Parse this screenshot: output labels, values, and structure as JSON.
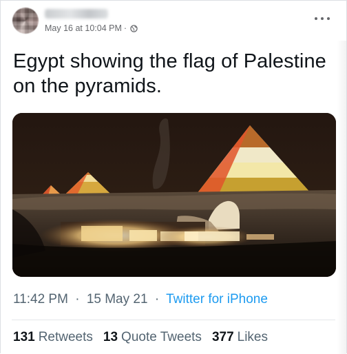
{
  "post": {
    "timestamp": "May 16 at 10:04 PM",
    "separator": "·",
    "privacy_icon": "globe-icon",
    "more_icon": "more-options-icon"
  },
  "tweet": {
    "text": "Egypt showing the flag of Palestine on the pyramids.",
    "photo": "photo of the Giza pyramids at night lit with the Palestinian flag colors",
    "time": "11:42 PM",
    "dot": "·",
    "date": "15 May 21",
    "source": "Twitter for iPhone",
    "stats": {
      "retweets_count": "131",
      "retweets_label": "Retweets",
      "quotes_count": "13",
      "quotes_label": "Quote Tweets",
      "likes_count": "377",
      "likes_label": "Likes"
    }
  },
  "colors": {
    "link_blue": "#1d9bf0",
    "meta_gray": "#536471",
    "text_dark": "#0f1419"
  }
}
